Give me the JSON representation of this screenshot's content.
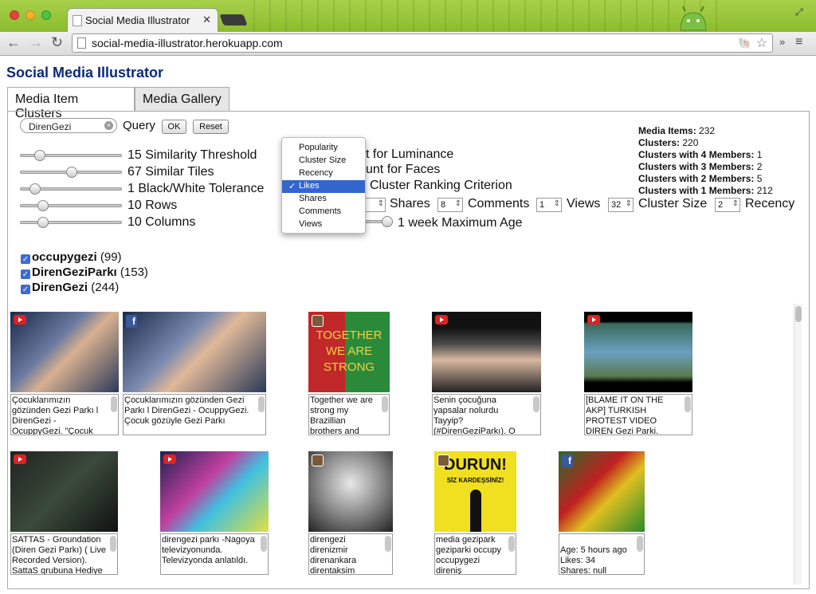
{
  "browser": {
    "tab_title": "Social Media Illustrator",
    "tab_close": "✕",
    "url": "social-media-illustrator.herokuapp.com",
    "back": "←",
    "forward": "→",
    "reload": "↻",
    "overflow": "»",
    "menu": "≡",
    "fullscreen": "⤢"
  },
  "page": {
    "title": "Social Media Illustrator",
    "tabs": [
      "Media Item Clusters",
      "Media Gallery"
    ]
  },
  "query": {
    "value": "DirenGezi",
    "clear": "×",
    "label": "Query",
    "ok": "OK",
    "reset": "Reset"
  },
  "sliders": [
    {
      "value": 15,
      "label": "15 Similarity Threshold",
      "fraction": 0.15
    },
    {
      "value": 67,
      "label": "67 Similar Tiles",
      "fraction": 0.5
    },
    {
      "value": 1,
      "label": "1 Black/White Tolerance",
      "fraction": 0.1
    },
    {
      "value": 10,
      "label": "10 Rows",
      "fraction": 0.18
    },
    {
      "value": 10,
      "label": "10 Columns",
      "fraction": 0.18
    }
  ],
  "hidden_options": {
    "luminance": "t for Luminance",
    "faces": "unt for Faces",
    "ranking": "Cluster Ranking Criterion",
    "likes_fragment": "es",
    "max_age": "1 week Maximum Age"
  },
  "weights": [
    {
      "value": "4",
      "label": "Shares"
    },
    {
      "value": "8",
      "label": "Comments"
    },
    {
      "value": "1",
      "label": "Views"
    },
    {
      "value": "32",
      "label": "Cluster Size"
    },
    {
      "value": "2",
      "label": "Recency"
    }
  ],
  "dropdown": {
    "options": [
      "Popularity",
      "Cluster Size",
      "Recency",
      "Likes",
      "Shares",
      "Comments",
      "Views"
    ],
    "selected": "Likes"
  },
  "stats": [
    {
      "label": "Media Items:",
      "value": "232"
    },
    {
      "label": "Clusters:",
      "value": "220"
    },
    {
      "label": "Clusters with 4 Members:",
      "value": "1"
    },
    {
      "label": "Clusters with 3 Members:",
      "value": "2"
    },
    {
      "label": "Clusters with 2 Members:",
      "value": "5"
    },
    {
      "label": "Clusters with 1 Members:",
      "value": "212"
    }
  ],
  "hashtags": [
    {
      "name": "occupygezi",
      "count": "(99)"
    },
    {
      "name": "DirenGeziParkı",
      "count": "(153)"
    },
    {
      "name": "DirenGezi",
      "count": "(244)"
    }
  ],
  "media": [
    {
      "source": "youtube",
      "caption": "Çocuklarımızın gözünden Gezi Parkı l DirenGezi - OcuppyGezi. \"Çocuk"
    },
    {
      "source": "facebook",
      "caption": "Çocuklarımızın gözünden Gezi Parkı l DirenGezi - OcuppyGezi. Çocuk gözüyle Gezi Parkı"
    },
    {
      "source": "instagram",
      "caption": "Together we are strong my Brazillian brothers and"
    },
    {
      "source": "youtube",
      "caption": "Senin çocuğuna yapsalar nolurdu Tayyip? (#DirenGeziParkı). O"
    },
    {
      "source": "youtube",
      "caption": "[BLAME IT ON THE AKP] TURKISH PROTEST VIDEO DIREN Gezi Parki."
    },
    {
      "source": "youtube",
      "caption": "SATTAS - Groundation (Diren Gezi Parkı) ( Live Recorded Version). SattaS grubuna Hediye"
    },
    {
      "source": "youtube",
      "caption": "direngezi parkı -Nagoya televizyonunda. Televizyonda anlatıldı."
    },
    {
      "source": "instagram",
      "caption": "direngezi direnizmir direnankara direntaksim"
    },
    {
      "source": "instagram",
      "caption": "media gezipark geziparki occupy occupygezi direniş"
    },
    {
      "source": "facebook",
      "caption": "Age: 5 hours ago\nLikes: 34\nShares: null"
    }
  ],
  "thumb_texts": {
    "brazil": "TOGETHER WE ARE STRONG",
    "durun": "DURUN!",
    "durun_sub": "SİZ KARDEŞSİNİZ!"
  },
  "colors": {
    "title": "#0b2a7a",
    "selection": "#3366cc",
    "chrome": "#8cbc2e"
  }
}
